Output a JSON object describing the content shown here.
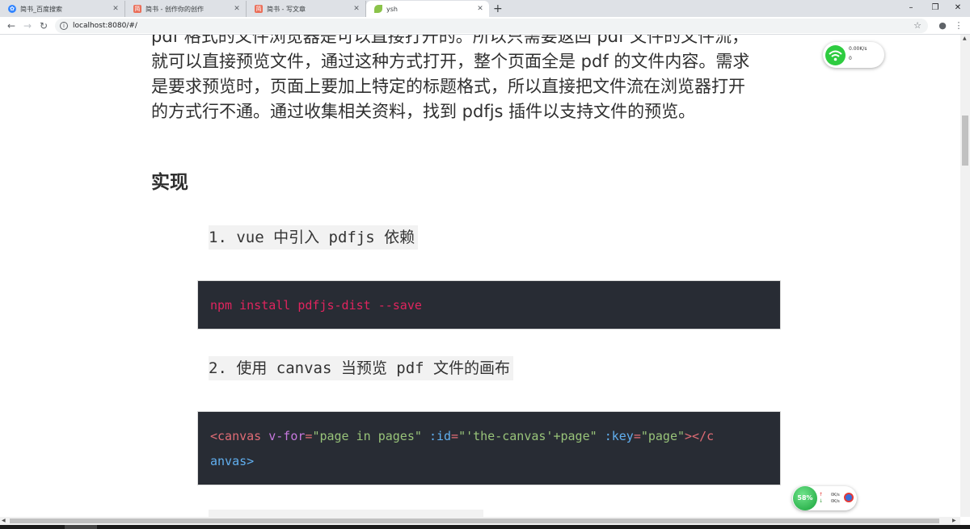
{
  "tabs": [
    {
      "label": "简书_百度搜索",
      "favicon": "baidu-paw"
    },
    {
      "label": "简书 - 创作你的创作",
      "favicon": "jianshu-logo"
    },
    {
      "label": "简书 - 写文章",
      "favicon": "jianshu-logo"
    },
    {
      "label": "ysh",
      "favicon": "leaf"
    }
  ],
  "window_controls": {
    "minimize": "–",
    "restore": "❐",
    "close": "✕"
  },
  "new_tab": "+",
  "toolbar": {
    "back": "←",
    "forward": "→",
    "reload": "↻",
    "url": "localhost:8080/#/",
    "star": "☆",
    "account": "●",
    "menu": "⋮"
  },
  "article": {
    "paragraph_lines": [
      "pdf 格式的文件浏览器是可以直接打开的。所以只需要返回 pdf 文件的文件流，",
      "就可以直接预览文件，通过这种方式打开，整个页面全是 pdf 的文件内容。需求",
      "是要求预览时，页面上要加上特定的标题格式，所以直接把文件流在浏览器打开",
      "的方式行不通。通过收集相关资料，找到 pdfjs 插件以支持文件的预览。"
    ],
    "heading": "实现",
    "step1": "1. vue 中引入 pdfjs 依赖",
    "code1": "npm install pdfjs-dist --save",
    "step2": "2. 使用 canvas 当预览 pdf 文件的画布",
    "code2": {
      "tag_open": "<canvas",
      "space1": " ",
      "directive": "v-for",
      "eq1": "=",
      "val1": "\"page in pages\"",
      "space2": " ",
      "attr2": ":id",
      "eq2": "=",
      "val2": "\"'the-canvas'+page\"",
      "space3": " ",
      "attr3": ":key",
      "eq3": "=",
      "val3": "\"page\"",
      "tag_mid": "></c",
      "tag_end": "anvas>"
    }
  },
  "net_widget": {
    "icon": "wifi-icon",
    "speed": "0.00K/s",
    "count": "0"
  },
  "sys_widget": {
    "cpu": "58%",
    "up": "0K/s",
    "down": "0K/s"
  },
  "colors": {
    "code_bg": "#282c34",
    "cmd": "#e0245e",
    "tag": "#e06c75",
    "string": "#98c379",
    "attr": "#61afef"
  }
}
